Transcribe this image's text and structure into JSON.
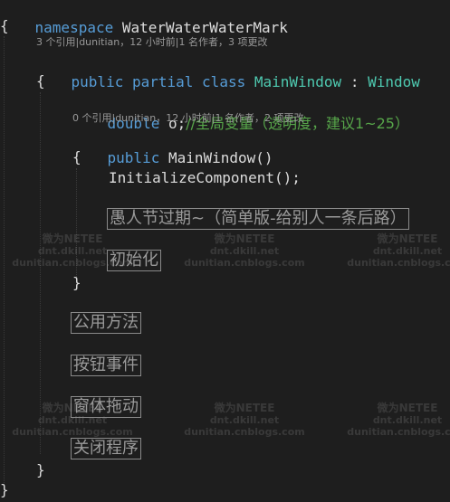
{
  "code": {
    "ns_keyword": "namespace",
    "ns_name": "WaterWaterWaterMark",
    "brace_open": "{",
    "brace_close": "}",
    "class_lens": "3 个引用|dunitian，12 小时前|1 名作者，3 项更改",
    "class_kw1": "public",
    "class_kw2": "partial",
    "class_kw3": "class",
    "class_name": "MainWindow",
    "class_colon": ":",
    "class_base": "Window",
    "field_type": "double",
    "field_name": "o;",
    "field_comment": "//全局变量（透明度，建议1~25）",
    "ctor_lens": "0 个引用|dunitian，12 小时前|1 名作者，2 项更改",
    "ctor_kw": "public",
    "ctor_sig": "MainWindow()",
    "init_call": "InitializeComponent();"
  },
  "regions": {
    "april_fools": "愚人节过期~（简单版-给别人一条后路）",
    "init": "初始化",
    "public_methods": "公用方法",
    "button_events": "按钮事件",
    "window_drag": "窗体拖动",
    "close_program": "关闭程序"
  },
  "watermark": {
    "line1": "微为NETEE",
    "line2": "dnt.dkill.net",
    "line3": "dunitian.cnblogs.com"
  }
}
